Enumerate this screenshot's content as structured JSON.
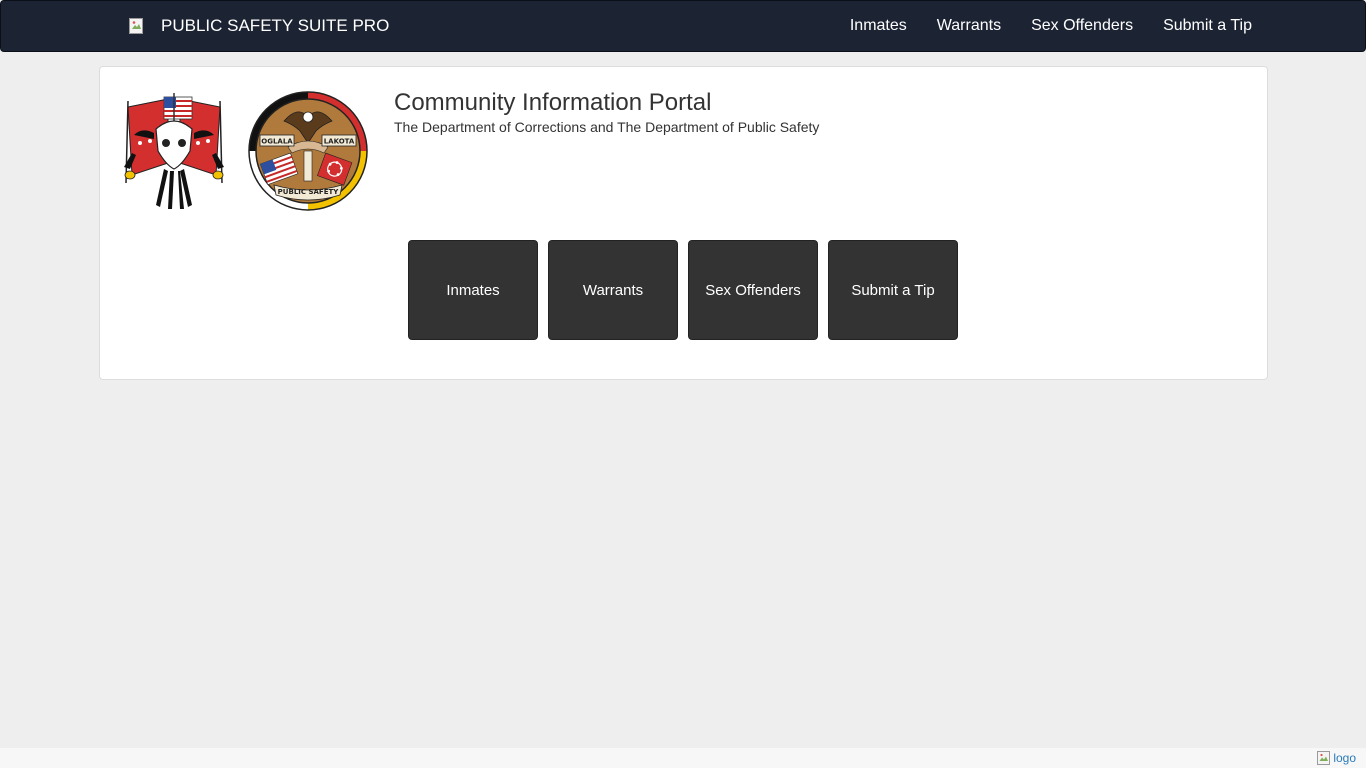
{
  "navbar": {
    "brand_text": "PUBLIC SAFETY SUITE PRO",
    "links": [
      {
        "label": "Inmates"
      },
      {
        "label": "Warrants"
      },
      {
        "label": "Sex Offenders"
      },
      {
        "label": "Submit a Tip"
      }
    ]
  },
  "header": {
    "title": "Community Information Portal",
    "subtitle": "The Department of Corrections and The Department of Public Safety",
    "seal_2_text": [
      "OGLALA",
      "LAKOTA",
      "PUBLIC SAFETY"
    ]
  },
  "tiles": [
    {
      "label": "Inmates"
    },
    {
      "label": "Warrants"
    },
    {
      "label": "Sex Offenders"
    },
    {
      "label": "Submit a Tip"
    }
  ],
  "footer": {
    "logo_alt": "logo"
  },
  "colors": {
    "navbar_bg": "#1c2333",
    "tile_bg": "#333333",
    "page_bg": "#eeeeee",
    "seal_red": "#d32f2f",
    "seal_yellow": "#f2c200"
  },
  "icons": {
    "brand": "broken-image-icon",
    "footer": "broken-image-icon",
    "seal_1": "tribal-flag-skull-seal",
    "seal_2": "oglala-lakota-public-safety-seal"
  }
}
